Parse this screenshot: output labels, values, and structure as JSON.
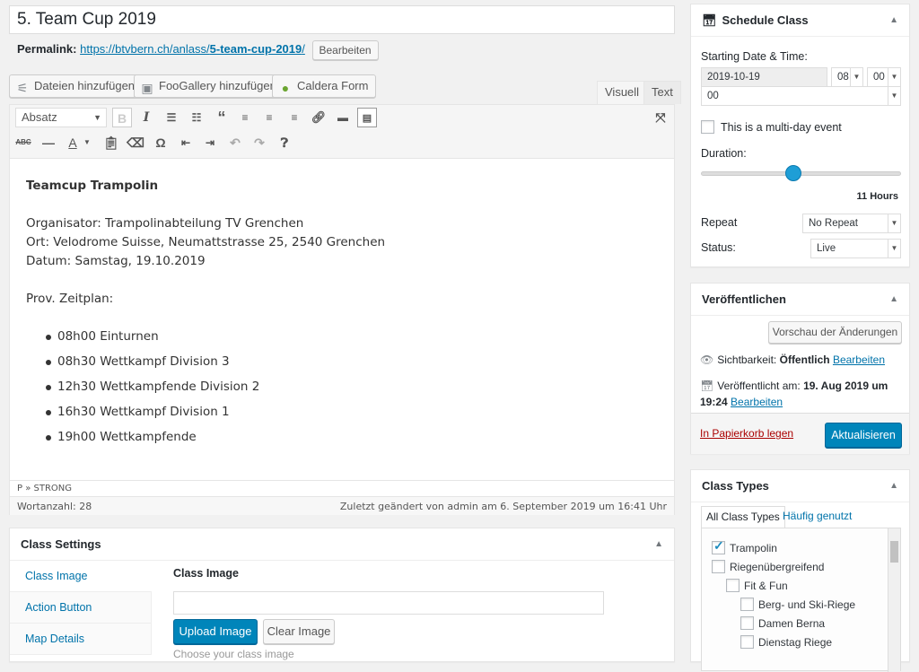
{
  "post": {
    "title": "5. Team Cup 2019",
    "permalink_label": "Permalink:",
    "permalink_base": "https://btvbern.ch/anlass/",
    "permalink_slug": "5-team-cup-2019",
    "permalink_trail": "/",
    "permalink_edit": "Bearbeiten"
  },
  "media": {
    "add_files": "Dateien hinzufügen",
    "foogallery": "FooGallery hinzufügen",
    "caldera": "Caldera Form"
  },
  "editor": {
    "tab_visual": "Visuell",
    "tab_text": "Text",
    "format_select": "Absatz",
    "heading": "Teamcup Trampolin",
    "lines": [
      "Organisator: Trampolinabteilung TV Grenchen",
      "Ort: Velodrome Suisse, Neumattstrasse 25, 2540 Grenchen",
      "Datum: Samstag, 19.10.2019"
    ],
    "schedule_title": "Prov. Zeitplan:",
    "schedule": [
      "08h00 Einturnen",
      "08h30 Wettkampf Division 3",
      "12h30 Wettkampfende Division 2",
      "16h30 Wettkampf Division 1",
      "19h00 Wettkampfende"
    ],
    "path": "P » STRONG",
    "word_count": "Wortanzahl: 28",
    "last_edited": "Zuletzt geändert von admin am 6. September 2019 um 16:41 Uhr"
  },
  "class_settings": {
    "title": "Class Settings",
    "tabs": [
      "Class Image",
      "Action Button",
      "Map Details"
    ],
    "field_label": "Class Image",
    "upload_btn": "Upload Image",
    "clear_btn": "Clear Image",
    "hint": "Choose your class image"
  },
  "schedule_class": {
    "title": "Schedule Class",
    "start_label": "Starting Date & Time:",
    "date": "2019-10-19",
    "hour": "08",
    "minute": "00",
    "second": "00",
    "multiday_label": "This is a multi-day event",
    "duration_label": "Duration:",
    "duration_value": "11 Hours",
    "duration_fraction": 0.46,
    "repeat_label": "Repeat",
    "repeat_value": "No Repeat",
    "status_label": "Status:",
    "status_value": "Live"
  },
  "publish": {
    "title": "Veröffentlichen",
    "preview_btn": "Vorschau der Änderungen",
    "visibility_label": "Sichtbarkeit:",
    "visibility_value": "Öffentlich",
    "visibility_edit": "Bearbeiten",
    "published_label": "Veröffentlicht am:",
    "published_value": "19. Aug 2019 um",
    "published_time": "19:24",
    "published_edit": "Bearbeiten",
    "trash": "In Papierkorb legen",
    "update_btn": "Aktualisieren"
  },
  "class_types": {
    "title": "Class Types",
    "tab_all": "All Class Types",
    "tab_popular": "Häufig genutzt",
    "items": [
      {
        "label": "Trampolin",
        "checked": true,
        "level": 0
      },
      {
        "label": "Riegenübergreifend",
        "checked": false,
        "level": 0
      },
      {
        "label": "Fit & Fun",
        "checked": false,
        "level": 1
      },
      {
        "label": "Berg- und Ski-Riege",
        "checked": false,
        "level": 2
      },
      {
        "label": "Damen Berna",
        "checked": false,
        "level": 2
      },
      {
        "label": "Dienstag Riege",
        "checked": false,
        "level": 2
      }
    ]
  },
  "colors": {
    "primary": "#0085ba",
    "link": "#0073aa",
    "trash": "#a00"
  }
}
